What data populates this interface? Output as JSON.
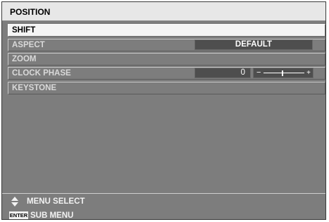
{
  "menu": {
    "title": "POSITION",
    "items": [
      {
        "label": "SHIFT"
      },
      {
        "label": "ASPECT",
        "value": "DEFAULT"
      },
      {
        "label": "ZOOM"
      },
      {
        "label": "CLOCK PHASE",
        "value": "0"
      },
      {
        "label": "KEYSTONE"
      }
    ],
    "clock_phase_slider": {
      "value": 0,
      "min_symbol": "−",
      "max_symbol": "+"
    }
  },
  "footer": {
    "line1": "MENU SELECT",
    "enter_key_label": "ENTER",
    "line2": "SUB MENU"
  },
  "colors": {
    "panel_bg": "#7d7d7d",
    "title_bg": "#e7e7e7",
    "selected_row_bg": "#f4f4f4",
    "value_box_bg": "#4e4e4e"
  },
  "icons": [
    "up-down-arrows-icon",
    "enter-key-icon"
  ]
}
